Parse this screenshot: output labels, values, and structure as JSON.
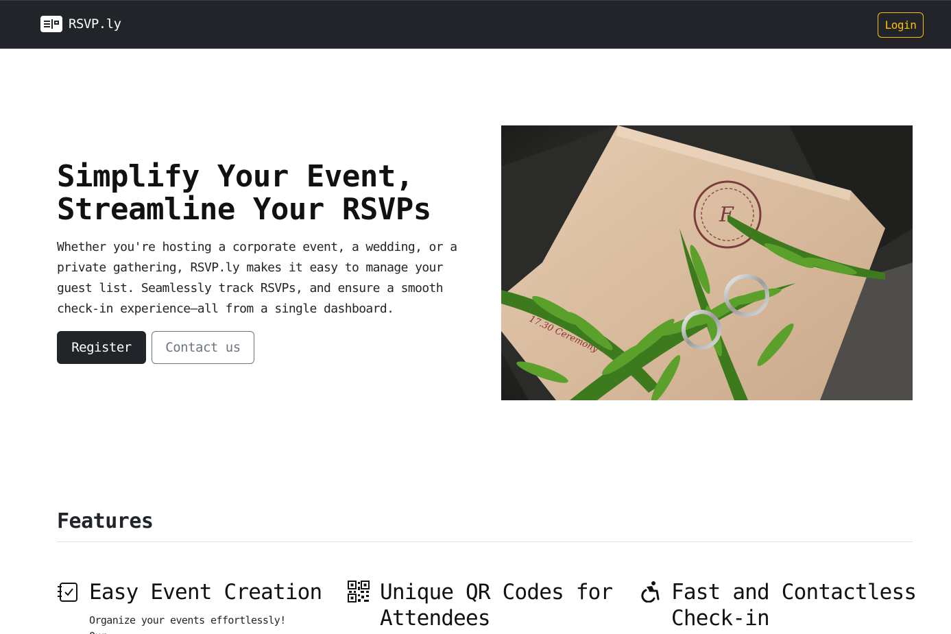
{
  "navbar": {
    "brand_name": "RSVP.ly",
    "login_label": "Login",
    "accent_color": "#ffc107",
    "background_color": "#212529"
  },
  "hero": {
    "title_line1": "Simplify Your Event,",
    "title_line2": "Streamline Your RSVPs",
    "lead": "Whether you're hosting a corporate event, a wedding, or a private gathering, RSVP.ly makes it easy to manage your guest list. Seamlessly track RSVPs, and ensure a smooth check-in experience—all from a single dashboard.",
    "register_label": "Register",
    "contact_label": "Contact us",
    "image_icon": "wedding-invitation-photo"
  },
  "features": {
    "title": "Features",
    "items": [
      {
        "icon": "checklist-icon",
        "title": "Easy Event Creation",
        "description": "Organize your events effortlessly! Our"
      },
      {
        "icon": "qr-code-icon",
        "title": "Unique QR Codes for Attendees",
        "description": ""
      },
      {
        "icon": "accessibility-icon",
        "title": "Fast and Contactless Check-in",
        "description": ""
      }
    ]
  }
}
